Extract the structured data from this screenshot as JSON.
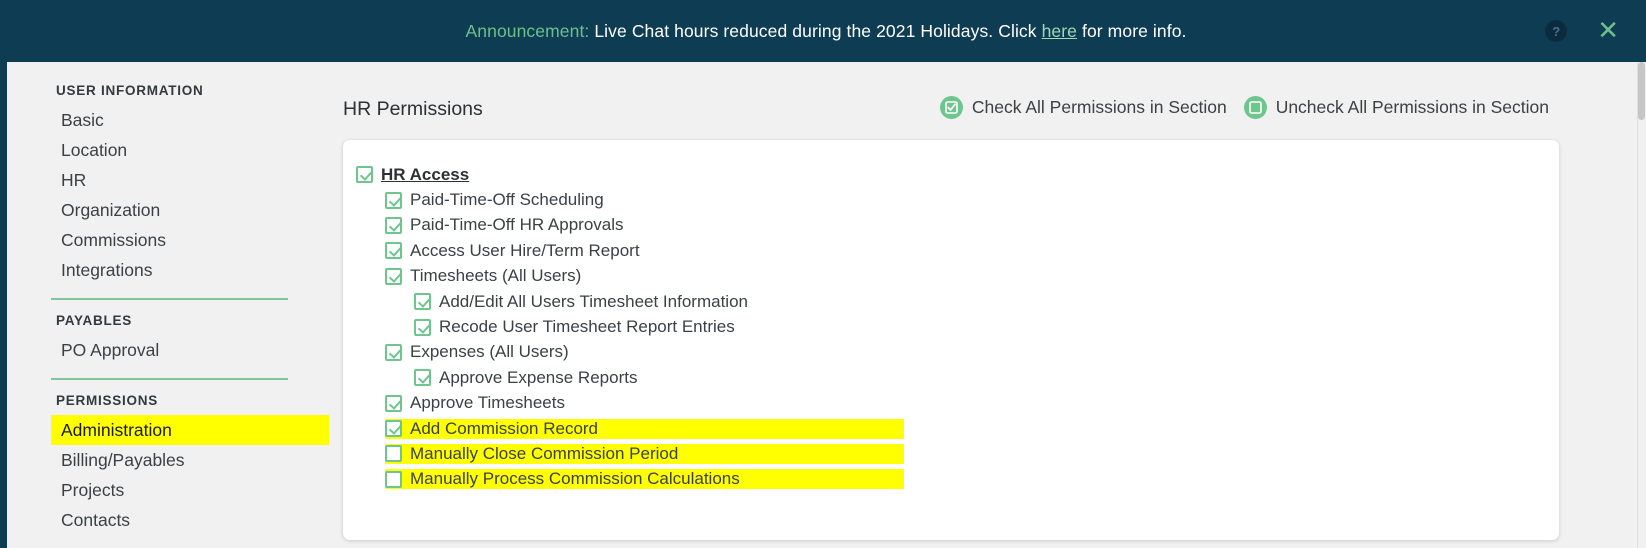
{
  "announcement": {
    "label": "Announcement:",
    "message_before_link": " Live Chat hours reduced during the 2021 Holidays. Click ",
    "link_text": "here",
    "message_after_link": " for more info.",
    "help_icon": "question-mark-icon",
    "help_glyph": "?",
    "close_icon": "close-icon",
    "close_glyph": "✕",
    "background_color": "#0e3c53",
    "label_color": "#6fbf8b",
    "link_color": "#9fd8b3"
  },
  "sidebar": {
    "sections": [
      {
        "title": "USER INFORMATION",
        "items": [
          {
            "label": "Basic",
            "highlighted": false
          },
          {
            "label": "Location",
            "highlighted": false
          },
          {
            "label": "HR",
            "highlighted": false
          },
          {
            "label": "Organization",
            "highlighted": false
          },
          {
            "label": "Commissions",
            "highlighted": false
          },
          {
            "label": "Integrations",
            "highlighted": false
          }
        ]
      },
      {
        "title": "PAYABLES",
        "items": [
          {
            "label": "PO Approval",
            "highlighted": false
          }
        ]
      },
      {
        "title": "PERMISSIONS",
        "items": [
          {
            "label": "Administration",
            "highlighted": true
          },
          {
            "label": "Billing/Payables",
            "highlighted": false
          },
          {
            "label": "Projects",
            "highlighted": false
          },
          {
            "label": "Contacts",
            "highlighted": false
          }
        ]
      }
    ],
    "divider_color": "#7fc79b",
    "highlight_color": "#ffff00"
  },
  "main": {
    "title": "HR Permissions",
    "bulk_actions": [
      {
        "icon": "check-all-icon",
        "label": "Check All Permissions in Section"
      },
      {
        "icon": "uncheck-all-icon",
        "label": "Uncheck All Permissions in Section"
      }
    ],
    "accent_color": "#6fc58e",
    "permissions": [
      {
        "label": "HR Access",
        "level": 0,
        "checked": true,
        "root": true,
        "highlighted": false
      },
      {
        "label": "Paid-Time-Off Scheduling",
        "level": 1,
        "checked": true,
        "root": false,
        "highlighted": false
      },
      {
        "label": "Paid-Time-Off HR Approvals",
        "level": 1,
        "checked": true,
        "root": false,
        "highlighted": false
      },
      {
        "label": "Access User Hire/Term Report",
        "level": 1,
        "checked": true,
        "root": false,
        "highlighted": false
      },
      {
        "label": "Timesheets (All Users)",
        "level": 1,
        "checked": true,
        "root": false,
        "highlighted": false
      },
      {
        "label": "Add/Edit All Users Timesheet Information",
        "level": 2,
        "checked": true,
        "root": false,
        "highlighted": false
      },
      {
        "label": "Recode User Timesheet Report Entries",
        "level": 2,
        "checked": true,
        "root": false,
        "highlighted": false
      },
      {
        "label": "Expenses (All Users)",
        "level": 1,
        "checked": true,
        "root": false,
        "highlighted": false
      },
      {
        "label": "Approve Expense Reports",
        "level": 2,
        "checked": true,
        "root": false,
        "highlighted": false
      },
      {
        "label": "Approve Timesheets",
        "level": 1,
        "checked": true,
        "root": false,
        "highlighted": false
      },
      {
        "label": "Add Commission Record",
        "level": 1,
        "checked": true,
        "root": false,
        "highlighted": true
      },
      {
        "label": "Manually Close Commission Period",
        "level": 1,
        "checked": false,
        "root": false,
        "highlighted": true
      },
      {
        "label": "Manually Process Commission Calculations",
        "level": 1,
        "checked": false,
        "root": false,
        "highlighted": true
      }
    ]
  }
}
